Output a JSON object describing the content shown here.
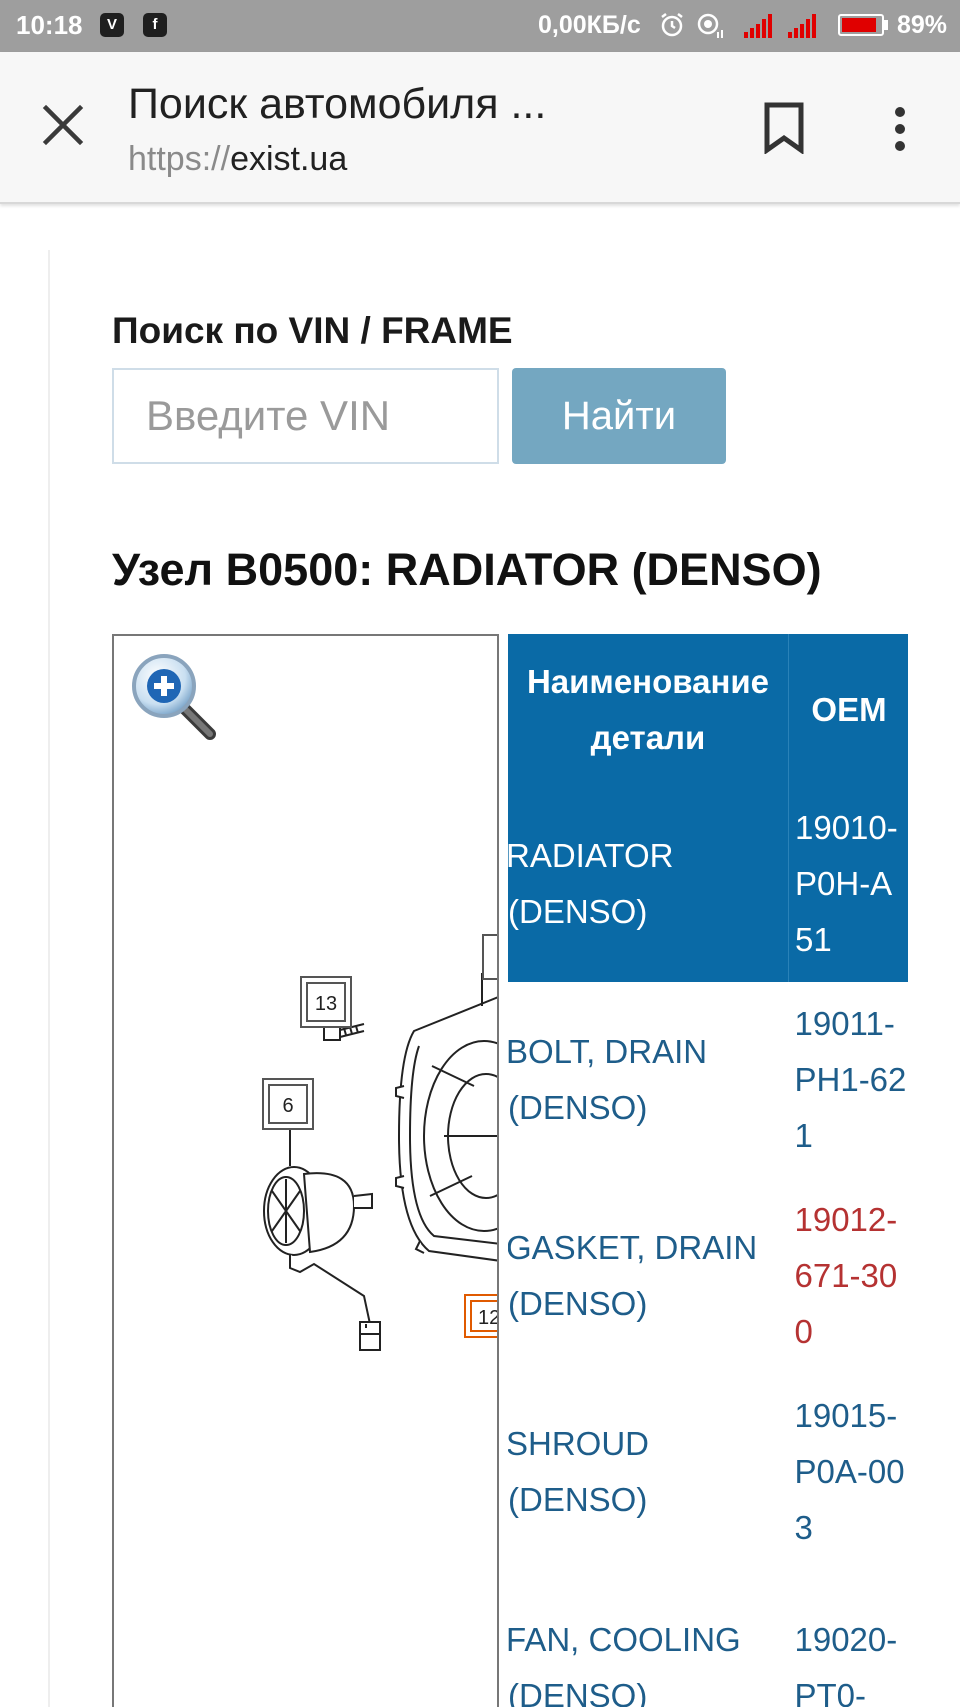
{
  "status_bar": {
    "time": "10:18",
    "apps": [
      {
        "name": "viber-icon",
        "glyph": "V"
      },
      {
        "name": "facebook-icon",
        "glyph": "f"
      }
    ],
    "network_speed": "0,00КБ/с",
    "icons": [
      "alarm-icon",
      "wifi-icon",
      "signal-icon",
      "signal-icon-2"
    ],
    "battery_percent": "89%",
    "battery_level": 0.89,
    "battery_color": "#e00000"
  },
  "browser": {
    "title": "Поиск автомобиля ...",
    "url_scheme": "https://",
    "url_host": "exist.ua",
    "close_icon": "close-icon",
    "bookmark_icon": "bookmark-icon",
    "menu_icon": "more-vertical-icon"
  },
  "vin_search": {
    "label": "Поиск по VIN / FRAME",
    "placeholder": "Введите VIN",
    "value": "",
    "button_label": "Найти",
    "button_color": "#74a7c1"
  },
  "unit": {
    "title": "Узел B0500: RADIATOR (DENSO)"
  },
  "diagram": {
    "zoom_icon": "zoom-in-icon",
    "callouts": [
      "13",
      "6",
      "12"
    ]
  },
  "parts_table": {
    "header_color": "#0a6aa6",
    "columns": [
      "Наименование детали",
      "OEM"
    ],
    "rows": [
      {
        "name": "RADIATOR (DENSO)",
        "oem": "19010-P0H-A51",
        "selected": true,
        "alert": false
      },
      {
        "name": "BOLT, DRAIN (DENSO)",
        "oem": "19011-PH1-621",
        "selected": false,
        "alert": false
      },
      {
        "name": "GASKET, DRAIN (DENSO)",
        "oem": "19012-671-300",
        "selected": false,
        "alert": true
      },
      {
        "name": "SHROUD (DENSO)",
        "oem": "19015-P0A-003",
        "selected": false,
        "alert": false
      },
      {
        "name": "FAN, COOLING (DENSO)",
        "oem": "19020-PT0-",
        "selected": false,
        "alert": false
      }
    ]
  }
}
